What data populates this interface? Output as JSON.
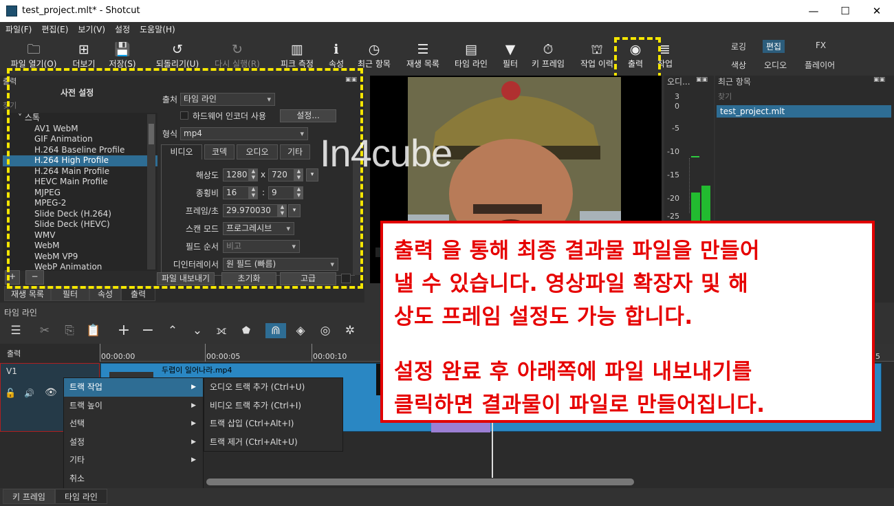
{
  "window": {
    "title": "test_project.mlt* - Shotcut",
    "minimize": "—",
    "maximize": "☐",
    "close": "✕"
  },
  "menu": [
    "파일(F)",
    "편집(E)",
    "보기(V)",
    "설정",
    "도움말(H)"
  ],
  "toolbar": [
    {
      "label": "파일 열기(O)",
      "icon": "folder-icon",
      "glyph": "🗀"
    },
    {
      "label": "더보기",
      "icon": "add-file-icon",
      "glyph": "⊞"
    },
    {
      "label": "저장(S)",
      "icon": "save-icon",
      "glyph": "💾"
    },
    {
      "label": "되돌리기(U)",
      "icon": "undo-icon",
      "glyph": "↺"
    },
    {
      "label": "다시 실행(R)",
      "icon": "redo-icon",
      "glyph": "↻",
      "disabled": true
    },
    {
      "label": "피크 측정",
      "icon": "meter-icon",
      "glyph": "▥"
    },
    {
      "label": "속성",
      "icon": "info-icon",
      "glyph": "ℹ"
    },
    {
      "label": "최근 항목",
      "icon": "clock-icon",
      "glyph": "◷"
    },
    {
      "label": "재생 목록",
      "icon": "list-icon",
      "glyph": "☰"
    },
    {
      "label": "타임 라인",
      "icon": "timeline-icon",
      "glyph": "▤"
    },
    {
      "label": "필터",
      "icon": "filter-icon",
      "glyph": "▼"
    },
    {
      "label": "키 프레임",
      "icon": "stopwatch-icon",
      "glyph": "⏱"
    },
    {
      "label": "작업 이력",
      "icon": "history-icon",
      "glyph": "⛫"
    },
    {
      "label": "출력",
      "icon": "disc-icon",
      "glyph": "◉"
    },
    {
      "label": "작업",
      "icon": "jobs-icon",
      "glyph": "≣"
    }
  ],
  "workspaces": {
    "row1": [
      "로깅",
      "편집",
      "FX"
    ],
    "row2": [
      "색상",
      "오디오",
      "플레이어"
    ],
    "selected": "편집"
  },
  "export_panel": {
    "dock_title": "출력",
    "presets_title": "사전 설정",
    "search_placeholder": "찾기",
    "group": "스톡",
    "presets": [
      "AV1 WebM",
      "GIF Animation",
      "H.264 Baseline Profile",
      "H.264 High Profile",
      "H.264 Main Profile",
      "HEVC Main Profile",
      "MJPEG",
      "MPEG-2",
      "Slide Deck (H.264)",
      "Slide Deck (HEVC)",
      "WMV",
      "WebM",
      "WebM VP9",
      "WebP Animation"
    ],
    "selected_preset": "H.264 High Profile",
    "add": "+",
    "remove": "−",
    "source_label": "출처",
    "source_value": "타임 라인",
    "hw_label": "하드웨어 인코더 사용",
    "settings_btn": "설정...",
    "format_label": "형식",
    "format_value": "mp4",
    "tabs": [
      "비디오",
      "코덱",
      "오디오",
      "기타"
    ],
    "resolution_label": "해상도",
    "width": "1280",
    "x_sep": "x",
    "height": "720",
    "aspect_label": "종횡비",
    "aspect_w": "16",
    "aspect_sep": ":",
    "aspect_h": "9",
    "fps_label": "프레임/초",
    "fps_value": "29.970030",
    "scan_label": "스캔 모드",
    "scan_value": "프로그레시브",
    "field_label": "필드 순서",
    "field_value": "비고",
    "deint_label": "디인터레이서",
    "deint_value": "원 필드 (빠름)",
    "export_btn": "파일 내보내기",
    "reset_btn": "초기화",
    "advanced_btn": "고급"
  },
  "dock_tabs": [
    "재생 목록",
    "필터",
    "속성",
    "출력"
  ],
  "watermark": "In4cube",
  "meter": {
    "title": "오디...",
    "labels": [
      "3",
      "0",
      "-5",
      "-10",
      "-15",
      "-20",
      "-25"
    ]
  },
  "recent": {
    "title": "최근 항목",
    "search_placeholder": "찾기",
    "items": [
      "test_project.mlt"
    ]
  },
  "timeline": {
    "title": "타임 라인",
    "output_label": "출력",
    "ruler": [
      "00:00:00",
      "00:00:05",
      "00:00:10"
    ],
    "ruler_right": "5",
    "track_name": "V1",
    "clip_name": "두렵이 일어나라.mp4"
  },
  "context_menu": {
    "items": [
      "트랙 작업",
      "트랙 높이",
      "선택",
      "설정",
      "기타",
      "취소"
    ],
    "submenu": [
      "오디오 트랙 추가 (Ctrl+U)",
      "비디오 트랙 추가 (Ctrl+I)",
      "트랙 삽입 (Ctrl+Alt+I)",
      "트랙 제거 (Ctrl+Alt+U)"
    ]
  },
  "bottom_tabs": [
    "키 프레임",
    "타임 라인"
  ],
  "annotation": {
    "lines": [
      "출력 을 통해 최종 결과물 파일을 만들어",
      "낼 수 있습니다. 영상파일 확장자 및 해",
      "상도 프레임 설정도 가능 합니다.",
      "설정 완료 후 아래쪽에 파일 내보내기를",
      "클릭하면 결과물이 파일로 만들어집니다."
    ]
  },
  "colors": {
    "accent": "#2e6d94",
    "highlight": "#f5e600",
    "annotation": "#e60000"
  }
}
